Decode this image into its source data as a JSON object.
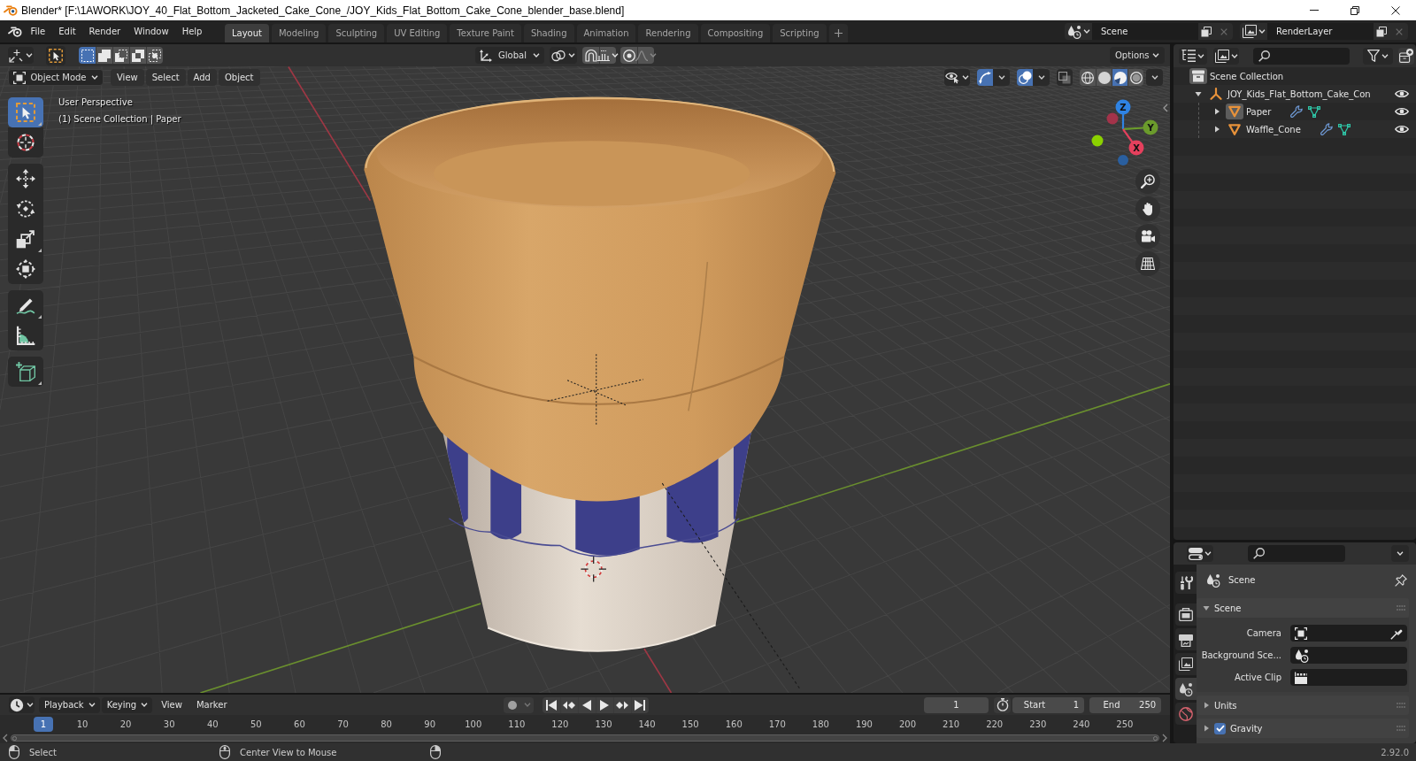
{
  "window": {
    "title": "Blender* [F:\\1AWORK\\JOY_40_Flat_Bottom_Jacketed_Cake_Cone_/JOY_Kids_Flat_Bottom_Cake_Cone_blender_base.blend]"
  },
  "menu": [
    "File",
    "Edit",
    "Render",
    "Window",
    "Help"
  ],
  "workspaces": [
    {
      "label": "Layout",
      "selected": true
    },
    {
      "label": "Modeling",
      "selected": false
    },
    {
      "label": "Sculpting",
      "selected": false
    },
    {
      "label": "UV Editing",
      "selected": false
    },
    {
      "label": "Texture Paint",
      "selected": false
    },
    {
      "label": "Shading",
      "selected": false
    },
    {
      "label": "Animation",
      "selected": false
    },
    {
      "label": "Rendering",
      "selected": false
    },
    {
      "label": "Compositing",
      "selected": false
    },
    {
      "label": "Scripting",
      "selected": false
    }
  ],
  "scene": "Scene",
  "view_layer": "RenderLayer",
  "tool_header": {
    "select_modes": [
      {
        "kind": "set",
        "selected": true
      },
      {
        "kind": "extend",
        "selected": false
      },
      {
        "kind": "subtract",
        "selected": false
      },
      {
        "kind": "difference",
        "selected": false
      },
      {
        "kind": "intersect",
        "selected": false
      }
    ],
    "orientation": "Global",
    "options": "Options"
  },
  "viewport": {
    "mode": "Object Mode",
    "menus": [
      "View",
      "Select",
      "Add",
      "Object"
    ],
    "toggles": [
      {
        "kind": "gizmos",
        "on": true
      },
      {
        "kind": "overlays",
        "on": true
      },
      {
        "kind": "xray",
        "on": false
      }
    ],
    "shading": [
      {
        "kind": "wireframe",
        "selected": false
      },
      {
        "kind": "solid",
        "selected": false
      },
      {
        "kind": "material",
        "selected": true
      },
      {
        "kind": "rendered",
        "selected": false
      }
    ],
    "info": [
      "User Perspective",
      "(1) Scene Collection | Paper"
    ],
    "tools": [
      {
        "kind": "select_box",
        "selected": true
      },
      {
        "kind": "cursor",
        "selected": false
      },
      {
        "kind": "move",
        "selected": false
      },
      {
        "kind": "rotate",
        "selected": false
      },
      {
        "kind": "scale",
        "selected": false
      },
      {
        "kind": "transform",
        "selected": false
      },
      {
        "kind": "annotate",
        "selected": false
      },
      {
        "kind": "measure",
        "selected": false
      },
      {
        "kind": "add_cube",
        "selected": false
      }
    ],
    "gizmo_axes": [
      "Z",
      "Y",
      "X"
    ]
  },
  "outliner": {
    "items": [
      {
        "name": "Scene Collection",
        "kind": "collection",
        "active": true,
        "children": [
          {
            "name": "JOY_Kids_Flat_Bottom_Cake_Con",
            "kind": "empty",
            "active": false,
            "expanded": true,
            "visible": true,
            "children": [
              {
                "name": "Paper",
                "kind": "mesh",
                "active": true,
                "expanded": false,
                "visible": true
              },
              {
                "name": "Waffle_Cone",
                "kind": "mesh",
                "active": false,
                "expanded": false,
                "visible": true
              }
            ]
          }
        ]
      }
    ]
  },
  "properties": {
    "tabs": [
      {
        "kind": "tool",
        "selected": false
      },
      {
        "kind": "render",
        "selected": false
      },
      {
        "kind": "output",
        "selected": false
      },
      {
        "kind": "view_layer",
        "selected": false
      },
      {
        "kind": "scene",
        "selected": true
      },
      {
        "kind": "world",
        "selected": false
      }
    ],
    "context": "Scene",
    "panels": [
      {
        "title": "Scene",
        "expanded": true,
        "fields": [
          {
            "label": "Camera",
            "kind": "camera"
          },
          {
            "label": "Background Sce...",
            "kind": "scene"
          },
          {
            "label": "Active Clip",
            "kind": "clip"
          }
        ]
      },
      {
        "title": "Units",
        "expanded": false
      },
      {
        "title": "Gravity",
        "expanded": false,
        "checked": true
      }
    ]
  },
  "timeline": {
    "menus": [
      {
        "label": "Playback",
        "kind": "dropdown"
      },
      {
        "label": "Keying",
        "kind": "dropdown"
      },
      {
        "label": "View",
        "kind": "menu"
      },
      {
        "label": "Marker",
        "kind": "menu"
      }
    ],
    "auto_keying": false,
    "current_frame": "1",
    "start": {
      "label": "Start",
      "value": "1"
    },
    "end": {
      "label": "End",
      "value": "250"
    },
    "playhead": "1",
    "ruler": [
      "10",
      "20",
      "30",
      "40",
      "50",
      "60",
      "70",
      "80",
      "90",
      "100",
      "110",
      "120",
      "130",
      "140",
      "150",
      "160",
      "170",
      "180",
      "190",
      "200",
      "210",
      "220",
      "230",
      "240",
      "250"
    ]
  },
  "status_bar": {
    "hints": [
      {
        "kind": "left_click",
        "text": "Select"
      },
      {
        "kind": "middle_click",
        "text": "Center View to Mouse"
      },
      {
        "kind": "right_click"
      }
    ],
    "version": "2.92.0"
  }
}
